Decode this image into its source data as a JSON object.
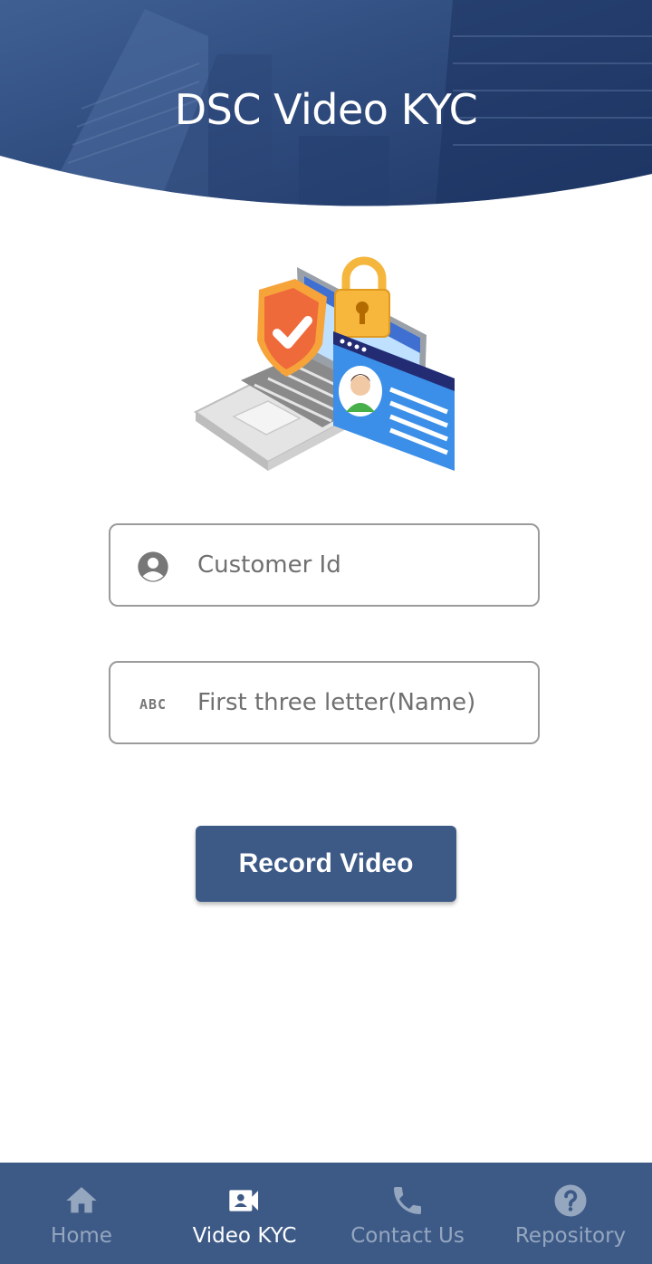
{
  "header": {
    "title": "DSC Video KYC"
  },
  "form": {
    "customer_id_placeholder": "Customer Id",
    "name_placeholder": "First three letter(Name)",
    "name_icon_text": "ABC"
  },
  "actions": {
    "record_label": "Record Video"
  },
  "bottom_nav": {
    "items": [
      {
        "label": "Home",
        "icon": "home-icon",
        "active": false
      },
      {
        "label": "Video KYC",
        "icon": "video-account-icon",
        "active": true
      },
      {
        "label": "Contact Us",
        "icon": "phone-icon",
        "active": false
      },
      {
        "label": "Repository",
        "icon": "help-circle-icon",
        "active": false
      }
    ]
  },
  "colors": {
    "primary": "#3d5a87",
    "inactive_nav": "#95a6bf",
    "field_border": "#9b9b9b",
    "placeholder": "#707070"
  }
}
